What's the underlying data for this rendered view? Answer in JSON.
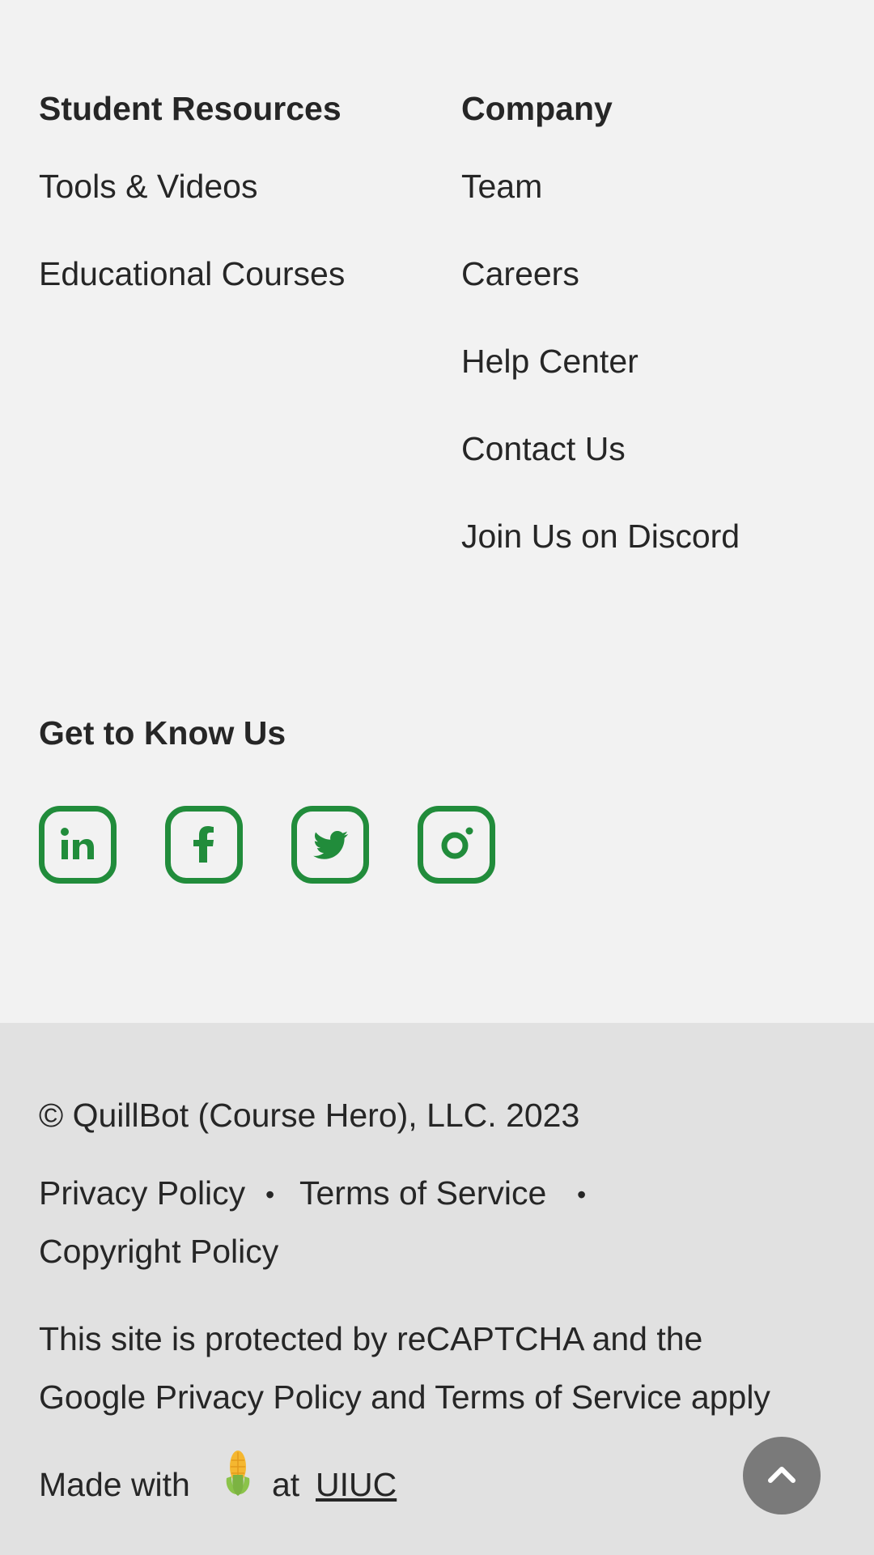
{
  "student_resources": {
    "heading": "Student Resources",
    "links": [
      "Tools & Videos",
      "Educational Courses"
    ]
  },
  "company": {
    "heading": "Company",
    "links": [
      "Team",
      "Careers",
      "Help Center",
      "Contact Us",
      "Join Us on Discord"
    ]
  },
  "social": {
    "heading": "Get to Know Us",
    "icons": [
      "linkedin-icon",
      "facebook-icon",
      "twitter-icon",
      "instagram-icon"
    ],
    "color": "#218c3b"
  },
  "legal": {
    "copyright": "© QuillBot (Course Hero), LLC. 2023",
    "privacy": "Privacy Policy",
    "terms": "Terms of Service",
    "copyright_policy": "Copyright Policy",
    "separator": "•",
    "recaptcha_line1": "This site is protected by reCAPTCHA and the",
    "recaptcha_line2": "Google Privacy Policy and Terms of Service apply",
    "made_with": "Made with",
    "at": "at",
    "uiuc": "UIUC",
    "corn_icon": "corn-icon"
  },
  "scroll_top": {
    "icon": "chevron-up-icon",
    "color": "#7a7a7a"
  }
}
